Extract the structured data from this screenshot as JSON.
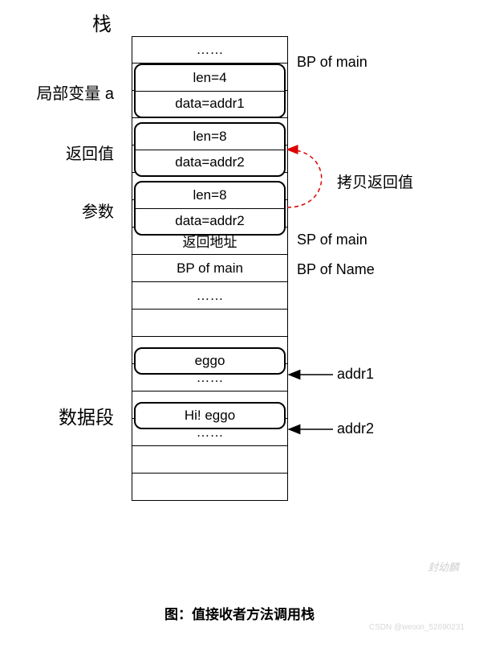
{
  "title_top": "栈",
  "cells": {
    "dots1": "……",
    "return_addr": "返回地址",
    "bp_main": "BP of main",
    "dots2": "……",
    "dots3": "……",
    "dots4": "……"
  },
  "blocks": {
    "var_a": {
      "r1": "len=4",
      "r2": "data=addr1"
    },
    "retval": {
      "r1": "len=8",
      "r2": "data=addr2"
    },
    "param": {
      "r1": "len=8",
      "r2": "data=addr2"
    },
    "eggo": {
      "r1": "eggo"
    },
    "hi_eggo": {
      "r1": "Hi! eggo"
    }
  },
  "left_labels": {
    "var_a": "局部变量 a",
    "retval": "返回值",
    "param": "参数",
    "data_seg": "数据段"
  },
  "right_labels": {
    "bp_main": "BP of main",
    "copy_ret": "拷贝返回值",
    "sp_main": "SP of main",
    "bp_name": "BP of Name",
    "addr1": "addr1",
    "addr2": "addr2"
  },
  "caption": "图：值接收者方法调用栈",
  "watermark1": "封幼麟",
  "watermark2": "CSDN @weixin_52690231"
}
